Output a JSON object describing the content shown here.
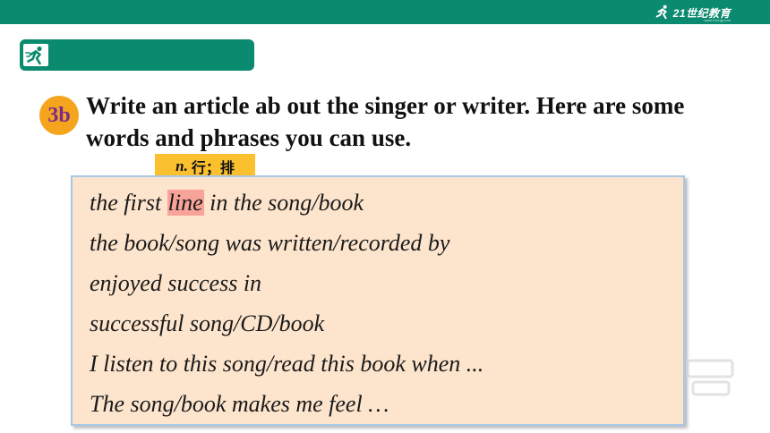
{
  "header": {
    "brand_text": "21世纪教育",
    "brand_sub": "www.21cnjy.com",
    "accent_color": "#0a8a6e"
  },
  "section": {
    "icon": "runner-icon",
    "badge_label": "3b"
  },
  "instruction": {
    "text": "Write an article ab out the singer or writer. Here are some words and phrases you can use."
  },
  "gloss": {
    "pos": "n.",
    "meaning": "行；排"
  },
  "phrases": {
    "item1_before": "the first ",
    "item1_highlight": "line",
    "item1_after": " in the song/book",
    "item2": "the book/song was written/recorded by",
    "item3": "enjoyed success in",
    "item4": "successful song/CD/book",
    "item5": "I listen to this song/read this book when ...",
    "item6": "The song/book makes me feel  …"
  }
}
